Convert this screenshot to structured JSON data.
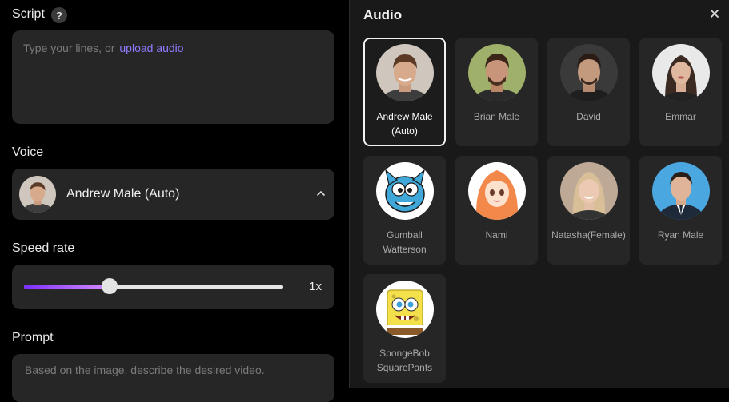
{
  "script": {
    "label": "Script",
    "help": "?",
    "placeholder": "Type your lines, or",
    "upload_link": "upload audio"
  },
  "voice": {
    "label": "Voice",
    "selected_name": "Andrew Male (Auto)"
  },
  "speed": {
    "label": "Speed rate",
    "value_label": "1x",
    "fraction": 0.33
  },
  "prompt": {
    "label": "Prompt",
    "placeholder": "Based on the image, describe the desired video."
  },
  "audio_panel": {
    "title": "Audio",
    "voices": [
      {
        "name": "Andrew Male (Auto)",
        "selected": true
      },
      {
        "name": "Brian Male",
        "selected": false
      },
      {
        "name": "David",
        "selected": false
      },
      {
        "name": "Emmar",
        "selected": false
      },
      {
        "name": "Gumball Watterson",
        "selected": false
      },
      {
        "name": "Nami",
        "selected": false
      },
      {
        "name": "Natasha(Female)",
        "selected": false
      },
      {
        "name": "Ryan Male",
        "selected": false
      },
      {
        "name": "SpongeBob SquarePants",
        "selected": false
      }
    ]
  },
  "colors": {
    "accent_link": "#8f7bff",
    "slider_start": "#7a2cff",
    "slider_end": "#d38cff"
  }
}
